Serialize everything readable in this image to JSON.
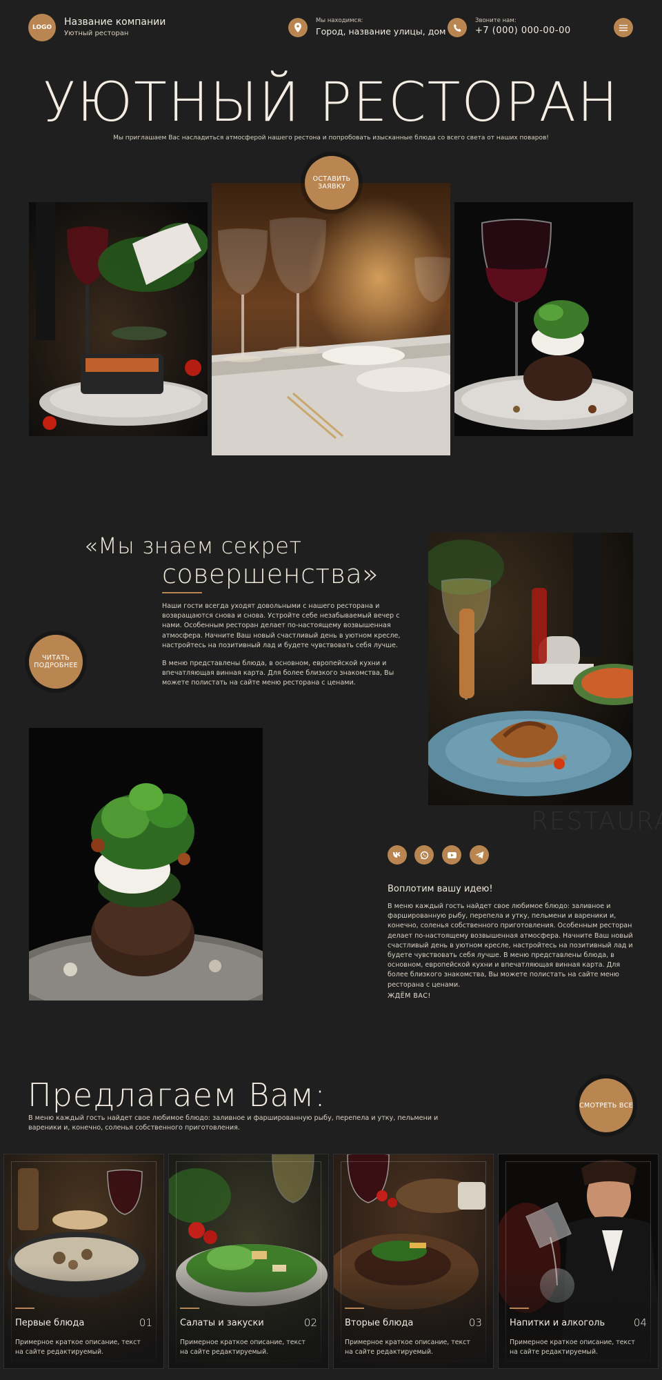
{
  "header": {
    "logo": "LOGO",
    "company_name": "Название компании",
    "company_sub": "Уютный ресторан",
    "location_label": "Мы находимся:",
    "location_value": "Город, название улицы, дом",
    "phone_label": "Звоните нам:",
    "phone_value": "+7 (000) 000-00-00"
  },
  "hero": {
    "title": "УЮТНЫЙ РЕСТОРАН",
    "subtitle": "Мы приглашаем Вас насладиться атмосферой нашего рестона и попробовать изысканные блюда со всего света от наших поваров!",
    "request_button": "ОСТАВИТЬ ЗАЯВКУ"
  },
  "about": {
    "quote_line1": "«Мы знаем секрет",
    "quote_line2": "совершенства»",
    "paragraph1": "Наши гости всегда уходят довольными с нашего ресторана и возвращаются снова и снова. Устройте себе незабываемый вечер с нами. Особенным ресторан  делает по-настоящему возвышенная атмосфера. Начните Ваш новый счастливый день в уютном кресле, настройтесь на позитивный лад и будете чувствовать себя лучше.",
    "paragraph2": "В меню представлены блюда, в основном, европейской кухни  и впечатляющая винная карта. Для более близкого знакомства, Вы можете полистать на сайте меню ресторана с ценами.",
    "read_more_button": "ЧИТАТЬ ПОДРОБНЕЕ",
    "watermark": "RESTAURANT"
  },
  "social": [
    "vk",
    "wa",
    "yt",
    "tg"
  ],
  "story": {
    "title": "Воплотим вашу идею!",
    "text": "В меню каждый гость найдет свое любимое блюдо: заливное и фаршированную рыбу, перепела и утку, пельмени и вареники и, конечно, соленья собственного приготовления. Особенным ресторан  делает по-настоящему возвышенная атмосфера. Начните Ваш новый счастливый день в уютном кресле, настройтесь на позитивный лад и будете чувствовать себя лучше. В меню представлены блюда, в основном, европейской кухни  и впечатляющая винная карта. Для более близкого знакомства, Вы можете полистать на сайте меню ресторана с ценами.",
    "wait": "ЖДЁМ ВАС!"
  },
  "offers": {
    "title": "Предлагаем Вам:",
    "text": "В меню каждый гость найдет свое любимое блюдо: заливное и фаршированную рыбу, перепела и утку, пельмени и вареники и, конечно, соленья собственного приготовления.",
    "see_all_button": "СМОТРЕТЬ ВСЕ",
    "cards": [
      {
        "name": "Первые блюда",
        "num": "01",
        "desc": "Примерное краткое описание, текст на сайте редактируемый."
      },
      {
        "name": "Салаты и закуски",
        "num": "02",
        "desc": "Примерное краткое описание, текст на сайте редактируемый."
      },
      {
        "name": "Вторые блюда",
        "num": "03",
        "desc": "Примерное краткое описание, текст на сайте редактируемый."
      },
      {
        "name": "Напитки и алкоголь",
        "num": "04",
        "desc": "Примерное краткое описание, текст на сайте редактируемый."
      }
    ]
  },
  "colors": {
    "background": "#1f1f1f",
    "accent": "#b98651",
    "text": "#e8e1d6"
  }
}
